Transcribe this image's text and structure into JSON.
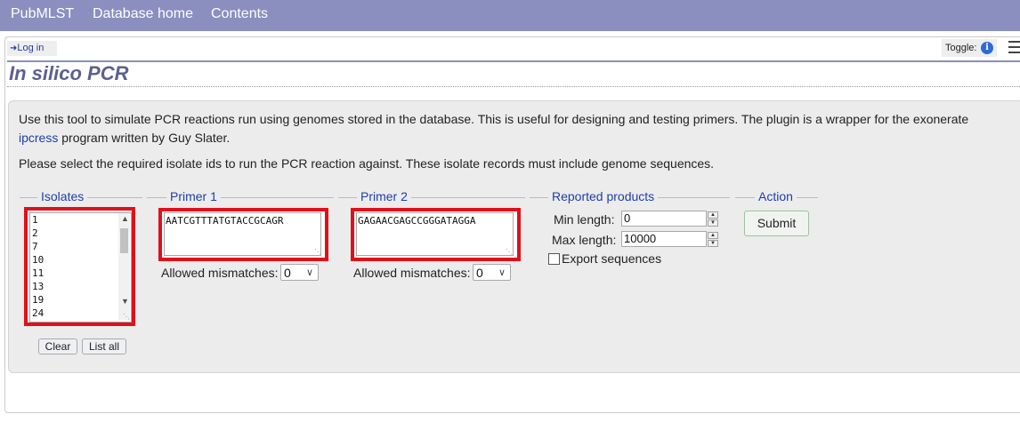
{
  "topnav": {
    "items": [
      "PubMLST",
      "Database home",
      "Contents"
    ]
  },
  "login": {
    "label": "Log in"
  },
  "toggle": {
    "label": "Toggle:",
    "icon": "info-icon"
  },
  "page": {
    "title": "In silico PCR"
  },
  "intro": {
    "text1": "Use this tool to simulate PCR reactions run using genomes stored in the database. This is useful for designing and testing primers. The plugin is a wrapper for the exonerate",
    "link": "ipcress",
    "text2": "program written by Guy Slater.",
    "text3": "Please select the required isolate ids to run the PCR reaction against. These isolate records must include genome sequences."
  },
  "isolates": {
    "legend": "Isolates",
    "items": [
      "1",
      "2",
      "7",
      "10",
      "11",
      "13",
      "19",
      "24"
    ],
    "clear_label": "Clear",
    "list_all_label": "List all"
  },
  "primer1": {
    "legend": "Primer 1",
    "value": "AATCGTTTATGTACCGCAGR",
    "mismatch_label": "Allowed mismatches:",
    "mismatch_value": "0"
  },
  "primer2": {
    "legend": "Primer 2",
    "value": "GAGAACGAGCCGGGATAGGA",
    "mismatch_label": "Allowed mismatches:",
    "mismatch_value": "0"
  },
  "products": {
    "legend": "Reported products",
    "min_label": "Min length:",
    "min_value": "0",
    "max_label": "Max length:",
    "max_value": "10000",
    "export_label": "Export sequences"
  },
  "action": {
    "legend": "Action",
    "submit_label": "Submit"
  },
  "colors": {
    "nav": "#8a8fbf",
    "link": "#1d3fa8",
    "highlight": "#e0101a"
  }
}
